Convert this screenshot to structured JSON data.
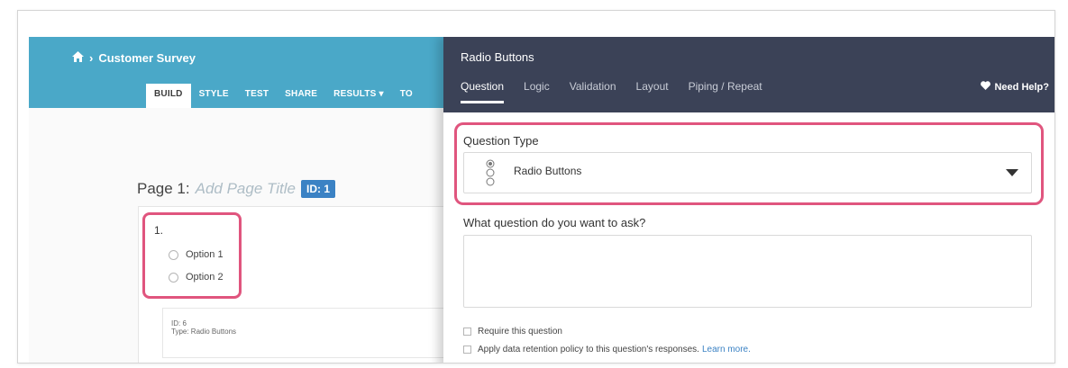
{
  "survey": {
    "breadcrumb": "Customer Survey",
    "tabs": [
      "BUILD",
      "STYLE",
      "TEST",
      "SHARE",
      "RESULTS ▾",
      "TO"
    ]
  },
  "page": {
    "label": "Page 1:",
    "title_placeholder": "Add Page Title",
    "id_badge": "ID: 1"
  },
  "question": {
    "number": "1.",
    "options": [
      "Option 1",
      "Option 2"
    ],
    "info_id": "ID: 6",
    "info_type": "Type: Radio Buttons"
  },
  "panel": {
    "title": "Radio Buttons",
    "tabs": [
      "Question",
      "Logic",
      "Validation",
      "Layout",
      "Piping / Repeat"
    ],
    "active_tab": "Question",
    "help": "Need Help?",
    "question_type_label": "Question Type",
    "question_type_value": "Radio Buttons",
    "ask_label": "What question do you want to ask?",
    "require_label": "Require this question",
    "retention_label": "Apply data retention policy to this question's responses.",
    "learn_more": "Learn more."
  },
  "colors": {
    "header_blue": "#4aa8c8",
    "panel_header": "#3b4257",
    "highlight": "#e0557e",
    "badge": "#3b82c4"
  }
}
